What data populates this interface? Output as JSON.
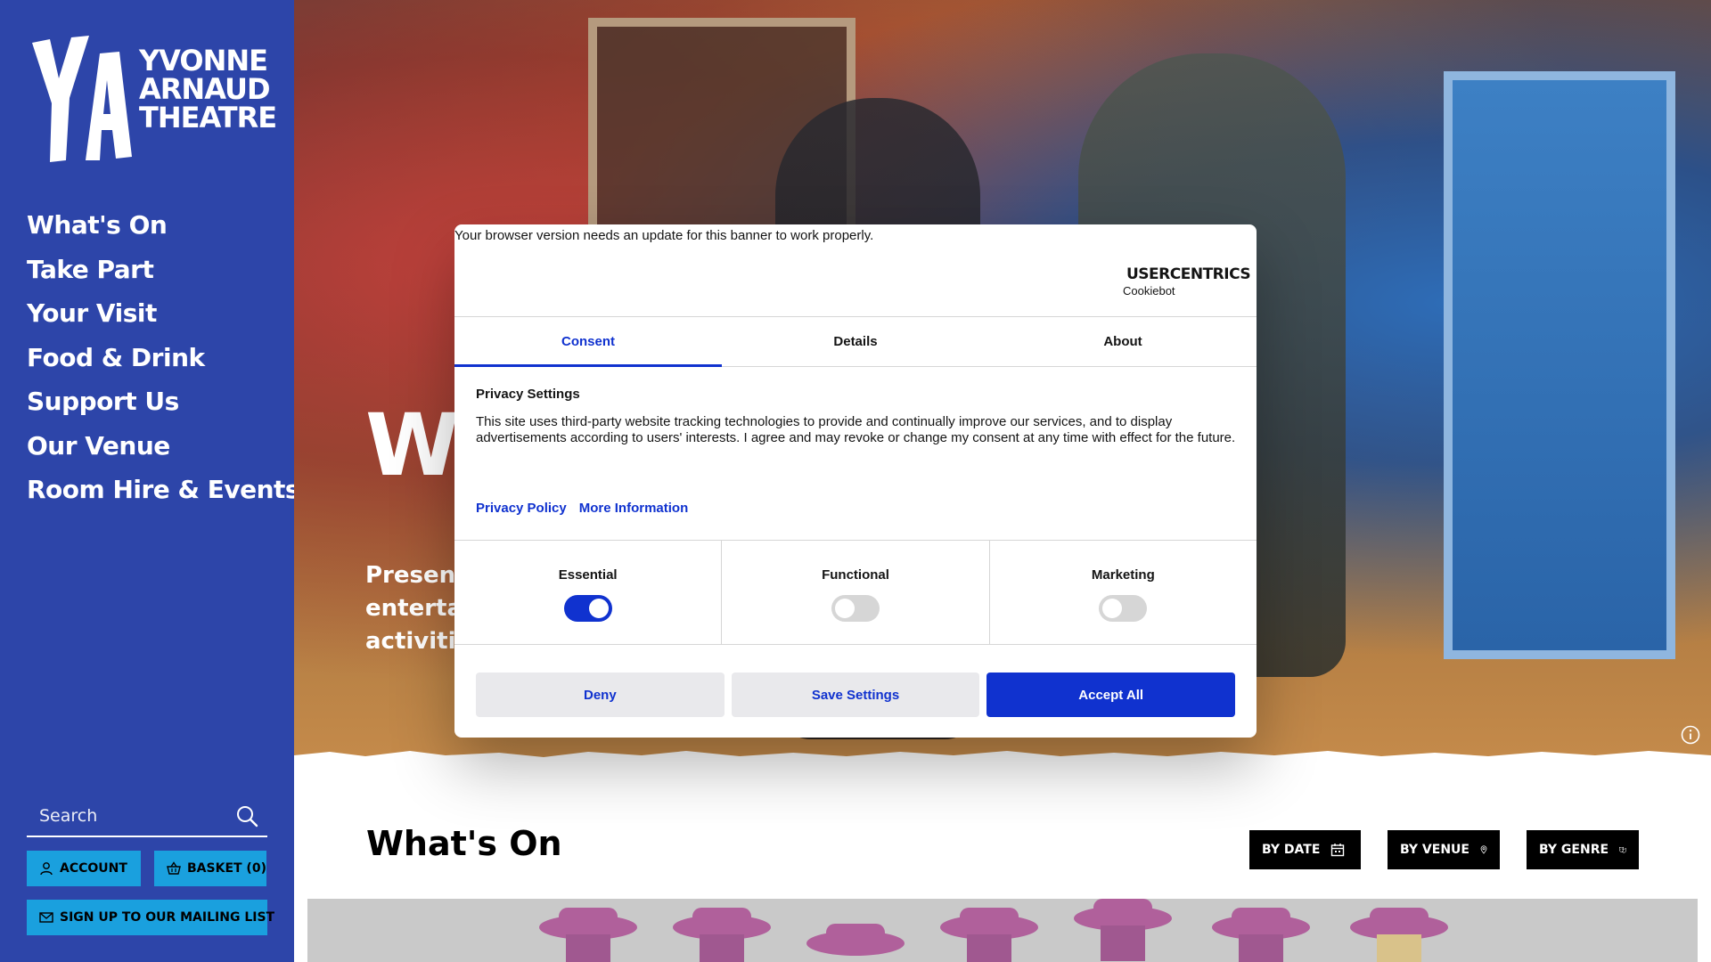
{
  "sidebar": {
    "logo": {
      "words": [
        "YVONNE",
        "ARNAUD",
        "THEATRE"
      ]
    },
    "nav": [
      {
        "label": "What's On"
      },
      {
        "label": "Take Part"
      },
      {
        "label": "Your Visit"
      },
      {
        "label": "Food & Drink"
      },
      {
        "label": "Support Us"
      },
      {
        "label": "Our Venue"
      },
      {
        "label": "Room Hire & Events"
      }
    ],
    "search": {
      "placeholder": "Search"
    },
    "account_label": "ACCOUNT",
    "basket_label": "BASKET (0)",
    "mailing_label": "SIGN UP TO OUR MAILING LIST"
  },
  "hero": {
    "title_visible": "We",
    "subtitle_lines": [
      "Presenti",
      "entertai",
      "activitie"
    ]
  },
  "whats_on": {
    "title": "What's On",
    "filters": [
      {
        "label": "BY DATE",
        "icon": "calendar-icon"
      },
      {
        "label": "BY VENUE",
        "icon": "map-pin-icon"
      },
      {
        "label": "BY GENRE",
        "icon": "theatre-masks-icon"
      }
    ]
  },
  "cookie_dialog": {
    "notice": "Your browser version needs an update for this banner to work properly.",
    "brand": {
      "name": "USERCENTRICS",
      "sub": "Cookiebot"
    },
    "tabs": [
      {
        "label": "Consent",
        "active": true
      },
      {
        "label": "Details",
        "active": false
      },
      {
        "label": "About",
        "active": false
      }
    ],
    "heading": "Privacy Settings",
    "body": "This site uses third-party website tracking technologies to provide and continually improve our services, and to display advertisements according to users' interests. I agree and may revoke or change my consent at any time with effect for the future.",
    "links": [
      "Privacy Policy",
      "More Information"
    ],
    "categories": [
      {
        "label": "Essential",
        "enabled": true
      },
      {
        "label": "Functional",
        "enabled": false
      },
      {
        "label": "Marketing",
        "enabled": false
      }
    ],
    "buttons": {
      "deny": "Deny",
      "save": "Save Settings",
      "accept": "Accept All"
    }
  },
  "colors": {
    "sidebar_bg": "#2d45a9",
    "sidebar_button": "#1aa0de",
    "dialog_accent": "#1032cf",
    "filter_button": "#000000"
  }
}
